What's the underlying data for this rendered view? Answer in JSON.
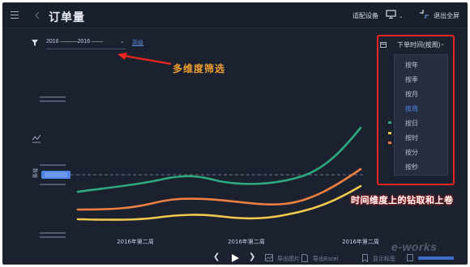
{
  "titlebar": {
    "title": "订单量",
    "adapt_device_label": "适配设备",
    "exit_fullscreen_label": "退出全屏"
  },
  "filter": {
    "date_range_text": "2016 ———2016 ——",
    "advanced_label": "高级"
  },
  "annotations": {
    "filter_note": "多维度筛选",
    "drill_note": "时间维度上的钻取和上卷"
  },
  "time_dropdown": {
    "label": "下单时间(按周)",
    "options": [
      "按年",
      "按季",
      "按月",
      "按周",
      "按日",
      "按时",
      "按分",
      "按秒"
    ],
    "selected": "按周"
  },
  "chart_data": {
    "type": "line",
    "x_tick_labels": [
      "2016年第二周",
      "2016年第二周",
      "2016年第二周"
    ],
    "series": [
      {
        "color": "#2ea87e"
      },
      {
        "color": "#ec7f42"
      },
      {
        "color": "#f0c94e"
      }
    ],
    "legend_colors": [
      "#2ea87e",
      "#f0c94e",
      "#ec7f42"
    ],
    "reference_line": "dashed",
    "y_axis_label": "数值"
  },
  "toolbar": {
    "export_image_label": "导出图片",
    "export_excel_label": "导出Excel",
    "show_tags_label": "显示标签"
  },
  "watermark": "e-works"
}
